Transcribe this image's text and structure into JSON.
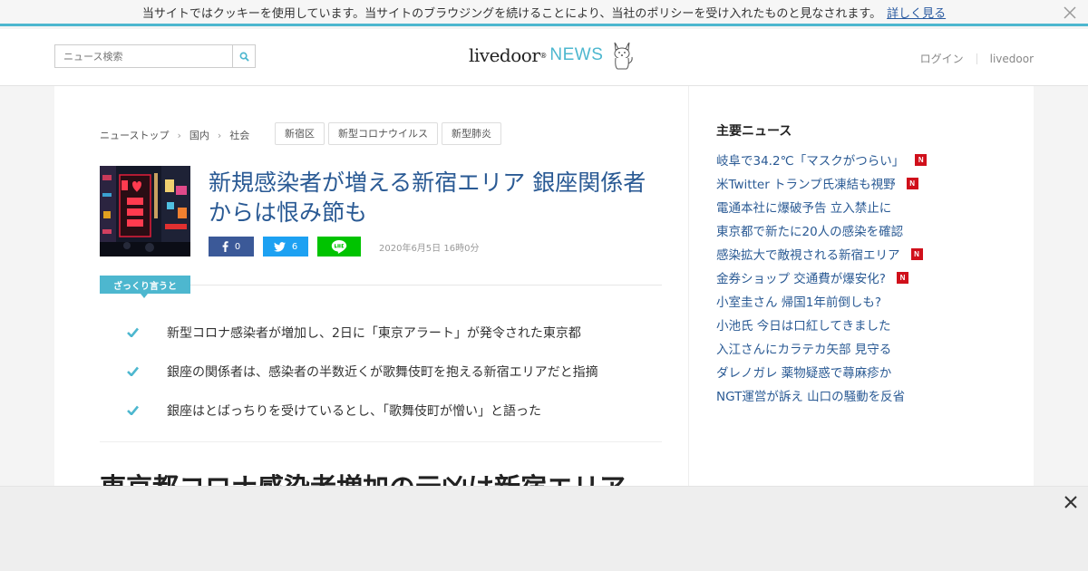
{
  "cookie": {
    "text": "当サイトではクッキーを使用しています。当サイトのブラウジングを続けることにより、当社のポリシーを受け入れたものと見なされます。",
    "link": "詳しく見る",
    "close_icon": "close-icon"
  },
  "header": {
    "search_placeholder": "ニュース検索",
    "search_icon": "search-icon",
    "logo_main": "livedoor",
    "logo_sup": "®",
    "logo_news": "NEWS",
    "login": "ログイン",
    "livedoor_link": "livedoor"
  },
  "breadcrumb": [
    "ニューストップ",
    "国内",
    "社会"
  ],
  "tags": [
    "新宿区",
    "新型コロナウイルス",
    "新型肺炎"
  ],
  "article": {
    "title": "新規感染者が増える新宿エリア 銀座関係者からは恨み節も",
    "share_fb": "0",
    "share_tw": "6",
    "date": "2020年6月5日 16時0分",
    "summary_label": "ざっくり言うと",
    "points": [
      "新型コロナ感染者が増加し、2日に「東京アラート」が発令された東京都",
      "銀座の関係者は、感染者の半数近くが歌舞伎町を抱える新宿エリアだと指摘",
      "銀座はとばっちりを受けているとし、「歌舞伎町が憎い」と語った"
    ],
    "body_heading": "東京都コロナ感染者増加の元凶は新宿エリア"
  },
  "sidebar": {
    "title": "主要ニュース",
    "items": [
      {
        "text": "岐阜で34.2℃「マスクがつらい」",
        "new": true
      },
      {
        "text": "米Twitter トランプ氏凍結も視野",
        "new": true
      },
      {
        "text": "電通本社に爆破予告 立入禁止に",
        "new": false
      },
      {
        "text": "東京都で新たに20人の感染を確認",
        "new": false
      },
      {
        "text": "感染拡大で敵視される新宿エリア",
        "new": true
      },
      {
        "text": "金券ショップ 交通費が爆安化?",
        "new": true
      },
      {
        "text": "小室圭さん 帰国1年前倒しも?",
        "new": false
      },
      {
        "text": "小池氏 今日は口紅してきました",
        "new": false
      },
      {
        "text": "入江さんにカラテカ矢部 見守る",
        "new": false
      },
      {
        "text": "ダレノガレ 薬物疑惑で蕁麻疹か",
        "new": false
      },
      {
        "text": "NGT運営が訴え 山口の騒動を反省",
        "new": false
      }
    ],
    "new_badge": "N"
  },
  "colors": {
    "accent": "#4db7cf",
    "link": "#2a5a94",
    "facebook": "#3b5998",
    "twitter": "#1da1f2",
    "line": "#00c300",
    "new_badge": "#d0101b"
  }
}
